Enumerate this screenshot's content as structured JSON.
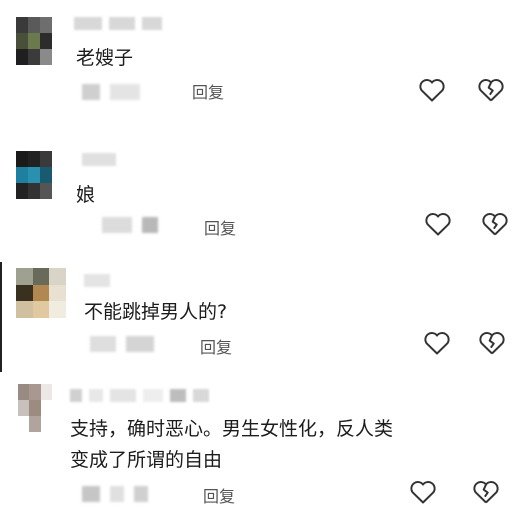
{
  "comments": [
    {
      "text": "老嫂子",
      "reply_label": "回复",
      "like_icon": "heart-icon",
      "dislike_icon": "broken-heart-icon"
    },
    {
      "text": "娘",
      "reply_label": "回复",
      "like_icon": "heart-icon",
      "dislike_icon": "broken-heart-icon"
    },
    {
      "text": "不能跳掉男人的?",
      "reply_label": "回复",
      "like_icon": "heart-icon",
      "dislike_icon": "broken-heart-icon"
    },
    {
      "text": "支持，确时恶心。男生女性化，反人类\n变成了所谓的自由",
      "reply_label": "回复",
      "like_icon": "heart-icon",
      "dislike_icon": "broken-heart-icon"
    }
  ],
  "colors": {
    "icon_stroke": "#333333",
    "reply_text": "#555555"
  }
}
